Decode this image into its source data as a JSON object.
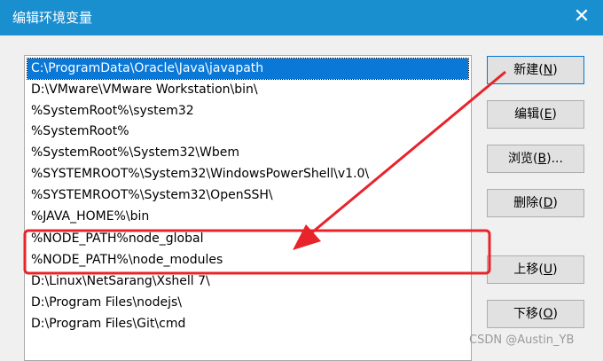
{
  "window": {
    "title": "编辑环境变量",
    "close_icon": "✕"
  },
  "list": {
    "items": [
      "C:\\ProgramData\\Oracle\\Java\\javapath",
      "D:\\VMware\\VMware Workstation\\bin\\",
      "%SystemRoot%\\system32",
      "%SystemRoot%",
      "%SystemRoot%\\System32\\Wbem",
      "%SYSTEMROOT%\\System32\\WindowsPowerShell\\v1.0\\",
      "%SYSTEMROOT%\\System32\\OpenSSH\\",
      "%JAVA_HOME%\\bin",
      "%NODE_PATH%node_global",
      "%NODE_PATH%\\node_modules",
      "D:\\Linux\\NetSarang\\Xshell 7\\",
      "D:\\Program Files\\nodejs\\",
      "D:\\Program Files\\Git\\cmd"
    ]
  },
  "buttons": {
    "new": {
      "text": "新建(",
      "key": "N",
      "end": ")"
    },
    "edit": {
      "text": "编辑(",
      "key": "E",
      "end": ")"
    },
    "browse": {
      "text": "浏览(",
      "key": "B",
      "end": ")..."
    },
    "delete": {
      "text": "删除(",
      "key": "D",
      "end": ")"
    },
    "move_up": {
      "text": "上移(",
      "key": "U",
      "end": ")"
    },
    "move_down": {
      "text": "下移(",
      "key": "O",
      "end": ")"
    }
  },
  "colors": {
    "titlebar": "#1a8fd0",
    "selection": "#0a78d7",
    "annotation": "#e8232a"
  },
  "watermark": "CSDN @Austin_YB"
}
